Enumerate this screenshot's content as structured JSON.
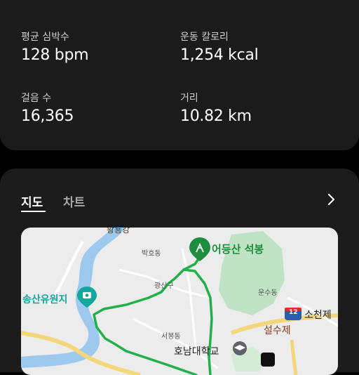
{
  "stats": {
    "items": [
      {
        "label": "평균 심박수",
        "value": "128 bpm"
      },
      {
        "label": "운동 칼로리",
        "value": "1,254 kcal"
      },
      {
        "label": "걸음 수",
        "value": "16,365"
      },
      {
        "label": "거리",
        "value": "10.82 km"
      }
    ]
  },
  "map_section": {
    "tabs": [
      {
        "label": "지도",
        "active": true
      },
      {
        "label": "차트",
        "active": false
      }
    ],
    "expand_icon": "chevron-right-icon"
  },
  "map": {
    "labels": {
      "river_top": "황룡강",
      "bakho": "박호동",
      "mountain": "어등산 석봉",
      "gwangsan": "광산구",
      "unsu": "운수동",
      "songsan_park": "송산유원지",
      "route12": "12",
      "socheonje": "소천제",
      "seolsuje": "설수제",
      "seobong": "서봉동",
      "honam_univ": "호남대학교"
    },
    "colors": {
      "route": "#22b04b",
      "water": "#9ec9ee",
      "park": "#bfe3c4",
      "road_yellow": "#f3d77a"
    }
  }
}
